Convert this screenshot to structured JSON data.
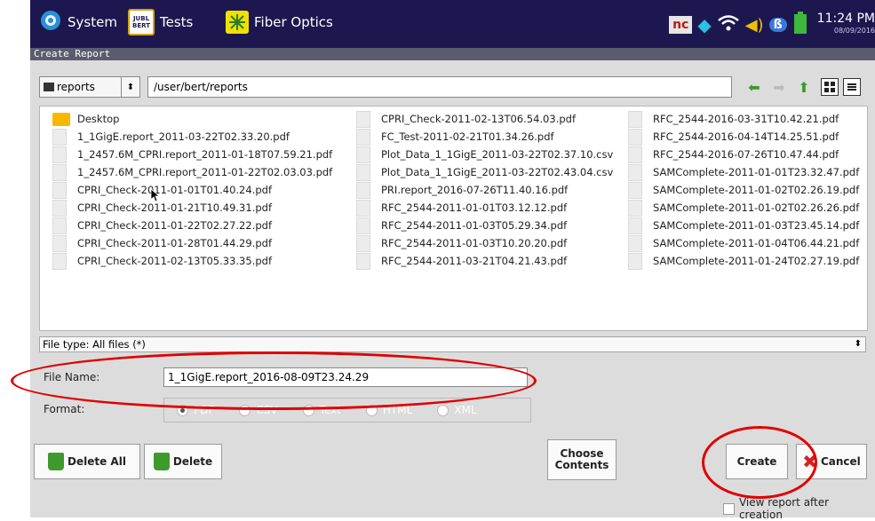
{
  "status_bar": {
    "tabs": [
      {
        "label": "System"
      },
      {
        "label": "Tests",
        "icon_text": "JUBL BERT"
      },
      {
        "label": "Fiber Optics"
      }
    ],
    "tray_icons": [
      "nc-icon",
      "network-icon",
      "wifi-icon",
      "speaker-icon",
      "bluetooth-icon",
      "battery-icon"
    ],
    "nc_label": "nc",
    "time": "11:24 PM",
    "date": "08/09/2016"
  },
  "dialog": {
    "title": "Create Report",
    "location": {
      "combo_value": "reports",
      "path": "/user/bert/reports"
    },
    "files": {
      "col1": [
        "Desktop",
        "1_1GigE.report_2011-03-22T02.33.20.pdf",
        "1_2457.6M_CPRI.report_2011-01-18T07.59.21.pdf",
        "1_2457.6M_CPRI.report_2011-01-22T02.03.03.pdf",
        "CPRI_Check-2011-01-01T01.40.24.pdf",
        "CPRI_Check-2011-01-21T10.49.31.pdf",
        "CPRI_Check-2011-01-22T02.27.22.pdf",
        "CPRI_Check-2011-01-28T01.44.29.pdf",
        "CPRI_Check-2011-02-13T05.33.35.pdf"
      ],
      "col2": [
        "CPRI_Check-2011-02-13T06.54.03.pdf",
        "FC_Test-2011-02-21T01.34.26.pdf",
        "Plot_Data_1_1GigE_2011-03-22T02.37.10.csv",
        "Plot_Data_1_1GigE_2011-03-22T02.43.04.csv",
        "PRI.report_2016-07-26T11.40.16.pdf",
        "RFC_2544-2011-01-01T03.12.12.pdf",
        "RFC_2544-2011-01-03T05.29.34.pdf",
        "RFC_2544-2011-01-03T10.20.20.pdf",
        "RFC_2544-2011-03-21T04.21.43.pdf"
      ],
      "col3": [
        "RFC_2544-2016-03-31T10.42.21.pdf",
        "RFC_2544-2016-04-14T14.25.51.pdf",
        "RFC_2544-2016-07-26T10.47.44.pdf",
        "SAMComplete-2011-01-01T23.32.47.pdf",
        "SAMComplete-2011-01-02T02.26.19.pdf",
        "SAMComplete-2011-01-02T02.26.26.pdf",
        "SAMComplete-2011-01-03T23.45.14.pdf",
        "SAMComplete-2011-01-04T06.44.21.pdf",
        "SAMComplete-2011-01-24T02.27.19.pdf"
      ]
    },
    "file_type": "File type: All files (*)",
    "file_name_label": "File Name:",
    "file_name_value": "1_1GigE.report_2016-08-09T23.24.29",
    "format_label": "Format:",
    "format_options": [
      "PDF",
      "CSV",
      "Text",
      "HTML",
      "XML"
    ],
    "format_selected": "PDF",
    "buttons": {
      "delete_all": "Delete All",
      "delete": "Delete",
      "choose_contents": "Choose Contents",
      "create": "Create",
      "cancel": "Cancel"
    },
    "view_after": "View report after creation"
  },
  "colors": {
    "status_bar": "#1d1750",
    "title_bar": "#5a5c6e",
    "dialog_bg": "#dcdcdc",
    "annotation": "#e00000",
    "trash": "#3e9a2d"
  }
}
